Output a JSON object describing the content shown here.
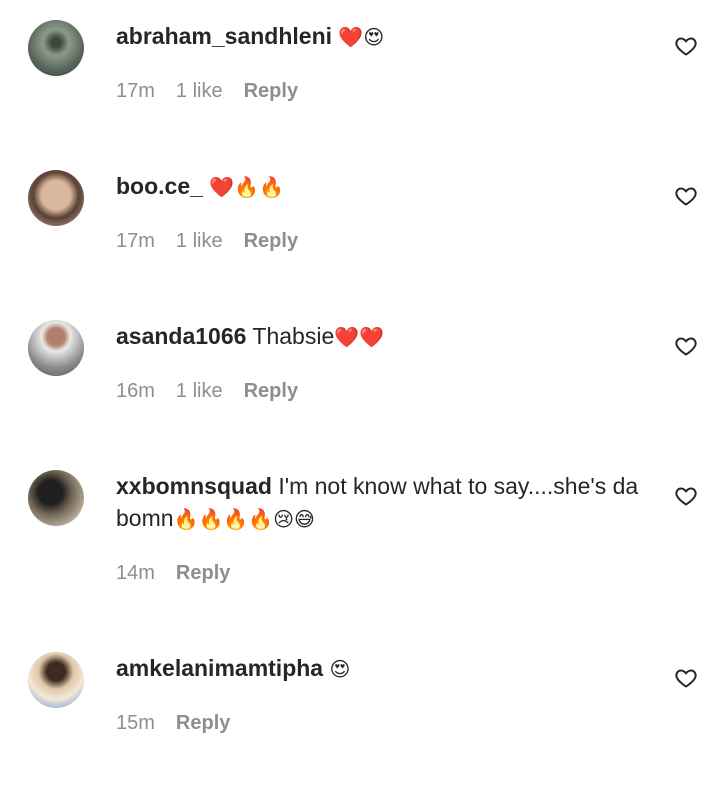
{
  "comments": [
    {
      "username": "abraham_sandhleni",
      "text": "",
      "emojis": "❤️😍",
      "time": "17m",
      "likes": "1 like",
      "reply": "Reply"
    },
    {
      "username": "boo.ce_",
      "text": "",
      "emojis": "❤️🔥🔥",
      "time": "17m",
      "likes": "1 like",
      "reply": "Reply"
    },
    {
      "username": "asanda1066",
      "text": "Thabsie",
      "emojis": "❤️❤️",
      "time": "16m",
      "likes": "1 like",
      "reply": "Reply"
    },
    {
      "username": "xxbomnsquad",
      "text": "I'm not know what to say....she's da bomn",
      "emojis": "🔥🔥🔥🔥😢😅",
      "time": "14m",
      "likes": "",
      "reply": "Reply"
    },
    {
      "username": "amkelanimamtipha",
      "text": "",
      "emojis": "😍",
      "time": "15m",
      "likes": "",
      "reply": "Reply"
    }
  ],
  "icons": {
    "like": "heart-outline-icon"
  },
  "colors": {
    "meta_text": "#8e8e8e",
    "username": "#262626",
    "heart": "#e0162b"
  }
}
